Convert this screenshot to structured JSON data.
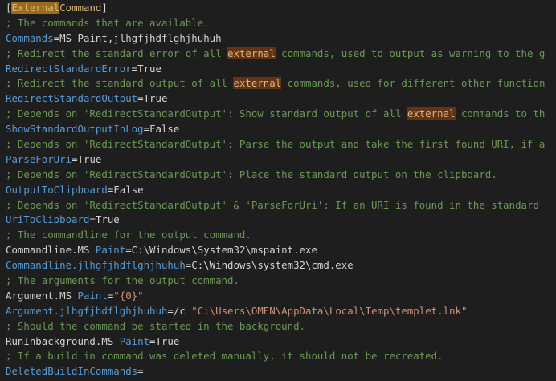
{
  "editor": {
    "colors": {
      "background": "#1e1e1e",
      "comment": "#6a9955",
      "key": "#569cd6",
      "value": "#d4d4d4",
      "string": "#ce9178",
      "highlight": "#623315"
    },
    "section": {
      "open": "[",
      "highlighted_part": "External",
      "rest": "Command",
      "close": "]"
    },
    "l01_comment": "; The commands that are available.",
    "l02_key": "Commands",
    "l02_eq": "=",
    "l02_val": "MS Paint,jlhgfjhdflghjhuhuh",
    "l03_c1": "; Redirect the standard error of all ",
    "l03_hl": "external",
    "l03_c2": " commands, used to output as warning to the g",
    "l04_key": "RedirectStandardError",
    "l04_eq": "=",
    "l04_val": "True",
    "l05_c1": "; Redirect the standard output of all ",
    "l05_hl": "external",
    "l05_c2": " commands, used for different other function",
    "l06_key": "RedirectStandardOutput",
    "l06_eq": "=",
    "l06_val": "True",
    "l07_c1": "; Depends on 'RedirectStandardOutput': Show standard output of all ",
    "l07_hl": "external",
    "l07_c2": " commands to th",
    "l08_key": "ShowStandardOutputInLog",
    "l08_eq": "=",
    "l08_val": "False",
    "l09_comment": "; Depends on 'RedirectStandardOutput': Parse the output and take the first found URI, if a",
    "l10_key": "ParseForUri",
    "l10_eq": "=",
    "l10_val": "True",
    "l11_comment": "; Depends on 'RedirectStandardOutput': Place the standard output on the clipboard.",
    "l12_key": "OutputToClipboard",
    "l12_eq": "=",
    "l12_val": "False",
    "l13_comment": "; Depends on 'RedirectStandardOutput' & 'ParseForUri': If an URI is found in the standard",
    "l14_key": "UriToClipboard",
    "l14_eq": "=",
    "l14_val": "True",
    "l15_comment": "; The commandline for the output command.",
    "l16_key_a": "Commandline.MS",
    "l16_key_b": " Paint",
    "l16_eq": "=",
    "l16_val": "C:\\Windows\\System32\\mspaint.exe",
    "l17_key": "Commandline.jlhgfjhdflghjhuhuh",
    "l17_eq": "=",
    "l17_val": "C:\\Windows\\system32\\cmd.exe",
    "l18_comment": "; The arguments for the output command.",
    "l19_key_a": "Argument.MS",
    "l19_key_b": " Paint",
    "l19_eq": "=",
    "l19_str": "\"{0}\"",
    "l20_key": "Argument.jlhgfjhdflghjhuhuh",
    "l20_eq": "=",
    "l20_val": "/c ",
    "l20_str": "\"C:\\Users\\OMEN\\AppData\\Local\\Temp\\templet.lnk\"",
    "l21_comment": "; Should the command be started in the background.",
    "l22_key_a": "RunInbackground.MS",
    "l22_key_b": " Paint",
    "l22_eq": "=",
    "l22_val": "True",
    "l23_comment": "; If a build in command was deleted manually, it should not be recreated.",
    "l24_key": "DeletedBuildInCommands",
    "l24_eq": "="
  }
}
